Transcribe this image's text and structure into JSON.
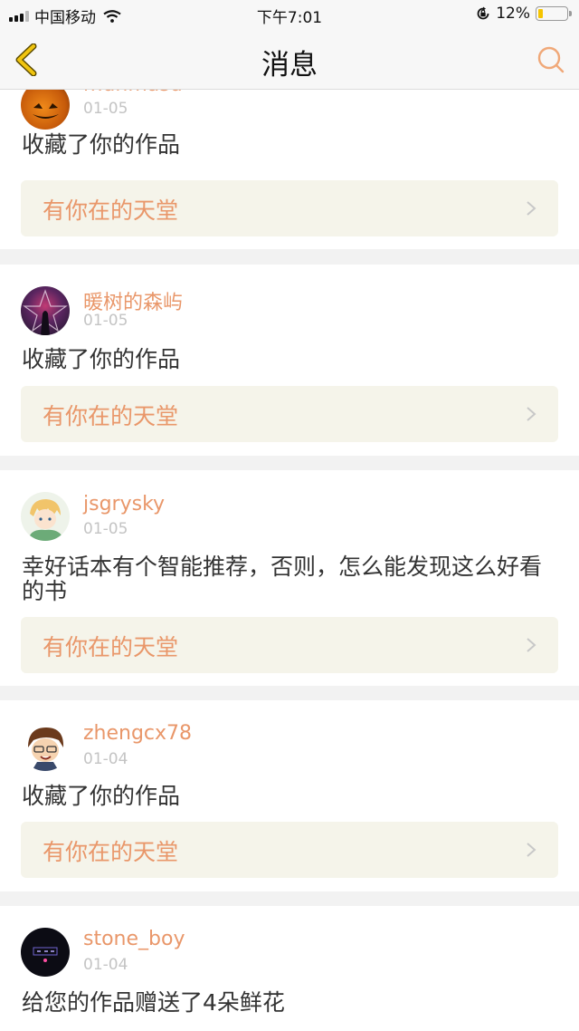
{
  "status_bar": {
    "carrier": "中国移动",
    "time": "下午7:01",
    "battery_percent": "12%",
    "battery_level": 0.12,
    "icons": [
      "signal-icon",
      "wifi-icon",
      "orientation-lock-icon",
      "battery-icon"
    ]
  },
  "navbar": {
    "title": "消息",
    "left_icon": "back-chevron-icon",
    "right_icon": "search-icon"
  },
  "colors": {
    "accent": "#e9976a",
    "back_icon": "#f0c40f",
    "work_bg": "#f5f4ea",
    "date": "#c4c4c4",
    "text": "#333333"
  },
  "messages": [
    {
      "username": "mdnmasd",
      "date": "01-05",
      "text": "收藏了你的作品",
      "work_title": "有你在的天堂",
      "avatar": "pumpkin-avatar"
    },
    {
      "username": "暖树的森屿",
      "date": "01-05",
      "text": "收藏了你的作品",
      "work_title": "有你在的天堂",
      "avatar": "pentagram-avatar"
    },
    {
      "username": "jsgrysky",
      "date": "01-05",
      "text": "幸好话本有个智能推荐，否则，怎么能发现这么好看的书",
      "work_title": "有你在的天堂",
      "avatar": "anime-boy-avatar"
    },
    {
      "username": "zhengcx78",
      "date": "01-04",
      "text": "收藏了你的作品",
      "work_title": "有你在的天堂",
      "avatar": "cartoon-boy-avatar"
    },
    {
      "username": "stone_boy",
      "date": "01-04",
      "text": "给您的作品赠送了4朵鲜花",
      "avatar": "dark-logo-avatar"
    }
  ]
}
